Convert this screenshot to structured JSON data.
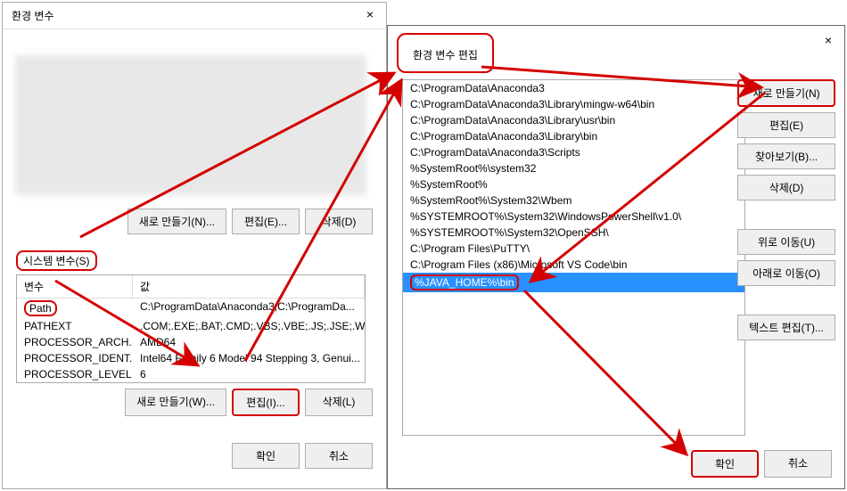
{
  "dialog1": {
    "title": "환경 변수",
    "user_section_buttons": {
      "new": "새로 만들기(N)...",
      "edit": "편집(E)...",
      "delete": "삭제(D)"
    },
    "system_label": "시스템 변수(S)",
    "table_headers": {
      "name": "변수",
      "value": "값"
    },
    "system_vars": [
      {
        "name": "Path",
        "value": "C:\\ProgramData\\Anaconda3;C:\\ProgramDa..."
      },
      {
        "name": "PATHEXT",
        "value": ".COM;.EXE;.BAT;.CMD;.VBS;.VBE;.JS;.JSE;.WSF;..."
      },
      {
        "name": "PROCESSOR_ARCH...",
        "value": "AMD64"
      },
      {
        "name": "PROCESSOR_IDENT...",
        "value": "Intel64 Family 6 Model 94 Stepping 3, Genui..."
      },
      {
        "name": "PROCESSOR_LEVEL",
        "value": "6"
      }
    ],
    "system_buttons": {
      "new": "새로 만들기(W)...",
      "edit": "편집(I)...",
      "delete": "삭제(L)"
    },
    "bottom": {
      "ok": "확인",
      "cancel": "취소"
    }
  },
  "dialog2": {
    "title": "환경 변수 편집",
    "paths": [
      "C:\\ProgramData\\Anaconda3",
      "C:\\ProgramData\\Anaconda3\\Library\\mingw-w64\\bin",
      "C:\\ProgramData\\Anaconda3\\Library\\usr\\bin",
      "C:\\ProgramData\\Anaconda3\\Library\\bin",
      "C:\\ProgramData\\Anaconda3\\Scripts",
      "%SystemRoot%\\system32",
      "%SystemRoot%",
      "%SystemRoot%\\System32\\Wbem",
      "%SYSTEMROOT%\\System32\\WindowsPowerShell\\v1.0\\",
      "%SYSTEMROOT%\\System32\\OpenSSH\\",
      "C:\\Program Files\\PuTTY\\",
      "C:\\Program Files (x86)\\Microsoft VS Code\\bin",
      "%JAVA_HOME%\\bin"
    ],
    "selected_index": 12,
    "buttons": {
      "new": "새로 만들기(N)",
      "edit": "편집(E)",
      "browse": "찾아보기(B)...",
      "delete": "삭제(D)",
      "up": "위로 이동(U)",
      "down": "아래로 이동(O)",
      "text_edit": "텍스트 편집(T)..."
    },
    "bottom": {
      "ok": "확인",
      "cancel": "취소"
    }
  }
}
